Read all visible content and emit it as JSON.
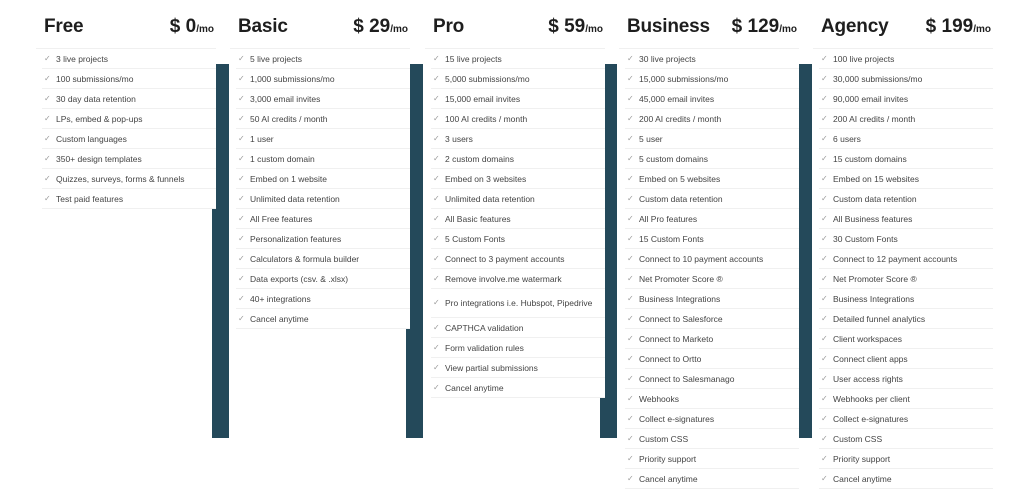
{
  "plans": [
    {
      "name": "Free",
      "price": "$ 0",
      "period": "/mo",
      "features": [
        "3 live projects",
        "100 submissions/mo",
        "30 day data retention",
        "LPs,  embed & pop-ups",
        "Custom languages",
        "350+ design templates",
        "Quizzes, surveys, forms & funnels",
        "Test paid features"
      ]
    },
    {
      "name": "Basic",
      "price": "$ 29",
      "period": "/mo",
      "features": [
        "5 live projects",
        "1,000 submissions/mo",
        "3,000 email invites",
        "50 AI credits / month",
        "1 user",
        "1 custom domain",
        "Embed on 1 website",
        "Unlimited data retention",
        "All Free features",
        "Personalization features",
        "Calculators & formula builder",
        "Data exports (csv. & .xlsx)",
        "40+ integrations",
        "Cancel anytime"
      ]
    },
    {
      "name": "Pro",
      "price": "$ 59",
      "period": "/mo",
      "features": [
        "15 live projects",
        "5,000 submissions/mo",
        "15,000 email invites",
        "100 AI credits / month",
        "3 users",
        "2 custom domains",
        "Embed on 3 websites",
        "Unlimited data retention",
        "All Basic features",
        "5 Custom Fonts",
        "Connect to 3 payment accounts",
        "Remove involve.me watermark",
        "Pro integrations i.e. Hubspot, Pipedrive",
        "CAPTHCA validation",
        "Form validation rules",
        "View partial submissions",
        "Cancel anytime"
      ]
    },
    {
      "name": "Business",
      "price": "$ 129",
      "period": "/mo",
      "features": [
        "30 live projects",
        "15,000 submissions/mo",
        "45,000 email invites",
        "200 AI credits / month",
        "5 user",
        "5 custom domains",
        "Embed on 5 websites",
        "Custom data retention",
        "All Pro features",
        "15 Custom Fonts",
        "Connect to 10 payment accounts",
        "Net Promoter Score ®",
        "Business Integrations",
        "Connect to Salesforce",
        "Connect to Marketo",
        "Connect to Ortto",
        "Connect to Salesmanago",
        "Webhooks",
        "Collect e-signatures",
        "Custom CSS",
        "Priority support",
        "Cancel anytime"
      ]
    },
    {
      "name": "Agency",
      "price": "$ 199",
      "period": "/mo",
      "features": [
        "100 live projects",
        "30,000 submissions/mo",
        "90,000 email invites",
        "200 AI credits / month",
        "6 users",
        "15 custom domains",
        "Embed on 15 websites",
        "Custom data retention",
        "All Business features",
        "30 Custom Fonts",
        "Connect to 12 payment accounts",
        "Net Promoter Score ®",
        "Business Integrations",
        "Detailed funnel analytics",
        "Client workspaces",
        "Connect client apps",
        "User access rights",
        "Webhooks per client",
        "Collect e-signatures",
        "Custom CSS",
        "Priority support",
        "Cancel anytime"
      ]
    }
  ],
  "check_icon": "✓",
  "colors": {
    "accent_bar": "#24495a"
  }
}
